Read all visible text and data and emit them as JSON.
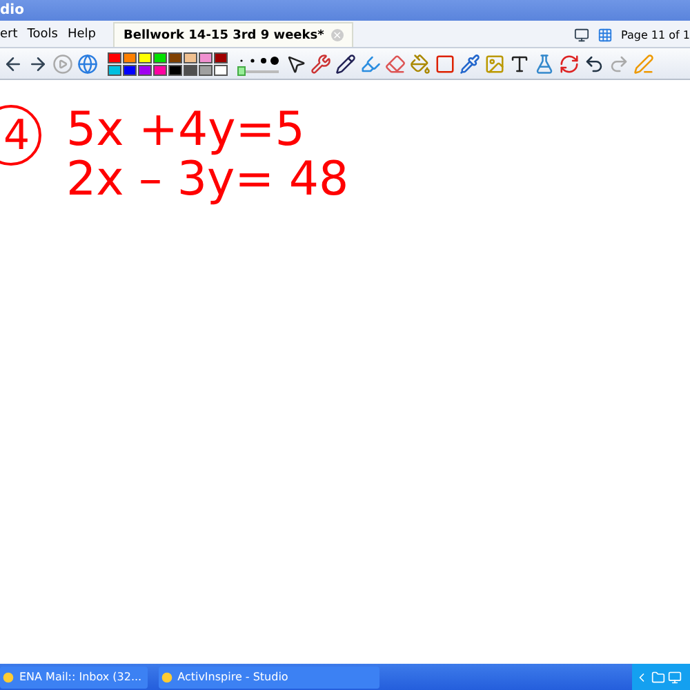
{
  "window": {
    "title": "dio"
  },
  "menu": [
    "ert",
    "Tools",
    "Help"
  ],
  "document_tab": {
    "label": "Bellwork 14-15 3rd 9 weeks*",
    "close": "×"
  },
  "page_indicator": "Page 11 of 1",
  "palette": [
    {
      "color": "#ff0000"
    },
    {
      "color": "#ff8000"
    },
    {
      "color": "#ffff00"
    },
    {
      "color": "#00e000"
    },
    {
      "color": "#804000"
    },
    {
      "color": "#f0c090"
    },
    {
      "color": "#f090d0"
    },
    {
      "color": "#a00000"
    },
    {
      "color": "#00c0e0"
    },
    {
      "color": "#0000ff"
    },
    {
      "color": "#a000f0"
    },
    {
      "color": "#ff00a0"
    },
    {
      "color": "#000000"
    },
    {
      "color": "#505050"
    },
    {
      "color": "#a0a0a0"
    },
    {
      "color": "#ffffff"
    }
  ],
  "pen_width": {
    "level": 0.0
  },
  "board": {
    "number": "4",
    "lines": [
      "5x +4y=5",
      "2x – 3y= 48"
    ]
  },
  "taskbar": [
    {
      "label": "ENA Mail:: Inbox (32...",
      "selected": false
    },
    {
      "label": "ActivInspire - Studio",
      "selected": false
    }
  ]
}
